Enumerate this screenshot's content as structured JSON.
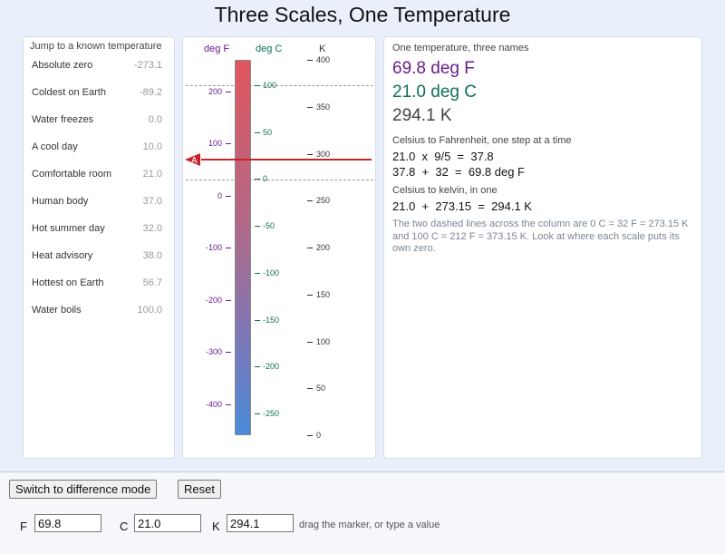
{
  "title": "Three Scales, One Temperature",
  "presets": {
    "heading": "Jump to a known temperature",
    "items": [
      {
        "label": "Absolute zero",
        "value": "-273.1"
      },
      {
        "label": "Coldest on Earth",
        "value": "-89.2"
      },
      {
        "label": "Water freezes",
        "value": "0.0"
      },
      {
        "label": "A cool day",
        "value": "10.0"
      },
      {
        "label": "Comfortable room",
        "value": "21.0"
      },
      {
        "label": "Human body",
        "value": "37.0"
      },
      {
        "label": "Hot summer day",
        "value": "32.0"
      },
      {
        "label": "Heat advisory",
        "value": "38.0"
      },
      {
        "label": "Hottest on Earth",
        "value": "56.7"
      },
      {
        "label": "Water boils",
        "value": "100.0"
      }
    ]
  },
  "scales": {
    "f_label": "deg F",
    "c_label": "deg C",
    "k_label": "K",
    "f_ticks": [
      "200",
      "100",
      "0",
      "-100",
      "-200",
      "-300",
      "-400"
    ],
    "c_ticks": [
      "100",
      "50",
      "0",
      "-50",
      "-100",
      "-150",
      "-200",
      "-250"
    ],
    "k_ticks": [
      "400",
      "350",
      "300",
      "250",
      "200",
      "150",
      "100",
      "50",
      "0"
    ],
    "marker_label": "A",
    "marker_celsius": 21.0,
    "colors": {
      "f": "#6a1b8a",
      "c": "#0f6e5a",
      "k": "#333333",
      "marker": "#c8232c"
    }
  },
  "readout": {
    "heading": "One temperature, three names",
    "f": "69.8 deg F",
    "c": "21.0 deg C",
    "k": "294.1 K",
    "c_to_f_heading": "Celsius to Fahrenheit, one step at a time",
    "c_to_f_step1": "21.0  x  9/5  =  37.8",
    "c_to_f_step2": "37.8  +  32  =  69.8 deg F",
    "c_to_k_heading": "Celsius to kelvin, in one",
    "c_to_k_step": "21.0  +  273.15  =  294.1 K",
    "note": "The two dashed lines across the column are 0 C = 32 F = 273.15 K and 100 C = 212 F = 373.15 K. Look at where each scale puts its own zero."
  },
  "controls": {
    "mode_button": "Switch to difference mode",
    "reset_button": "Reset",
    "f_label": "F",
    "c_label": "C",
    "k_label": "K",
    "f_value": "69.8",
    "c_value": "21.0",
    "k_value": "294.1",
    "hint": "drag the marker, or type a value"
  }
}
